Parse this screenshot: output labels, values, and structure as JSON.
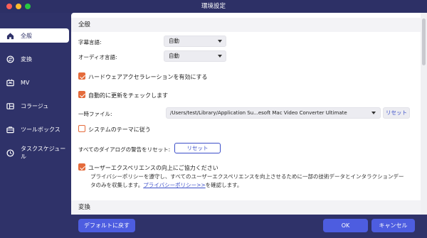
{
  "window": {
    "title": "環境設定"
  },
  "colors": {
    "sidebar_bg": "#2f3269",
    "accent": "#e56b3b",
    "primary": "#4d5de0",
    "link": "#3b4ec8"
  },
  "sidebar": {
    "items": [
      {
        "label": "全般",
        "icon": "home-icon",
        "active": true
      },
      {
        "label": "変換",
        "icon": "convert-icon",
        "active": false
      },
      {
        "label": "MV",
        "icon": "mv-icon",
        "active": false
      },
      {
        "label": "コラージュ",
        "icon": "collage-icon",
        "active": false
      },
      {
        "label": "ツールボックス",
        "icon": "toolbox-icon",
        "active": false
      },
      {
        "label": "タスクスケジュール",
        "icon": "clock-icon",
        "active": false
      }
    ]
  },
  "general": {
    "section_title": "全般",
    "subtitle_language": {
      "label": "字幕言語:",
      "value": "自動"
    },
    "audio_language": {
      "label": "オーディオ言語:",
      "value": "自動"
    },
    "hardware_accel": {
      "label": "ハードウェアアクセラレーションを有効にする",
      "checked": true
    },
    "auto_update": {
      "label": "自動的に更新をチェックします",
      "checked": true
    },
    "temp_file": {
      "label": "一時ファイル:",
      "path": "/Users/test/Library/Application Su...esoft Mac Video Converter Ultimate",
      "reset_label": "リセット"
    },
    "system_theme": {
      "label": "システムのテーマに従う",
      "checked": false
    },
    "dialog_reset": {
      "label": "すべてのダイアログの警告をリセット:",
      "button_label": "リセット"
    },
    "ux_program": {
      "label": "ユーザーエクスペリエンスの向上にご協力ください",
      "checked": true,
      "desc_line1": "プライバシーポリシーを遵守し、すべてのユーザーエクスペリエンスを向上させるために一部の技術データとインタラクションデー",
      "desc_line2_prefix": "タのみを収集します。",
      "desc_link": "プライバシーポリシー>>",
      "desc_line2_suffix": "を確認します。"
    }
  },
  "convert_section": {
    "title": "変換"
  },
  "footer": {
    "default_label": "デフォルトに戻す",
    "ok_label": "OK",
    "cancel_label": "キャンセル"
  }
}
